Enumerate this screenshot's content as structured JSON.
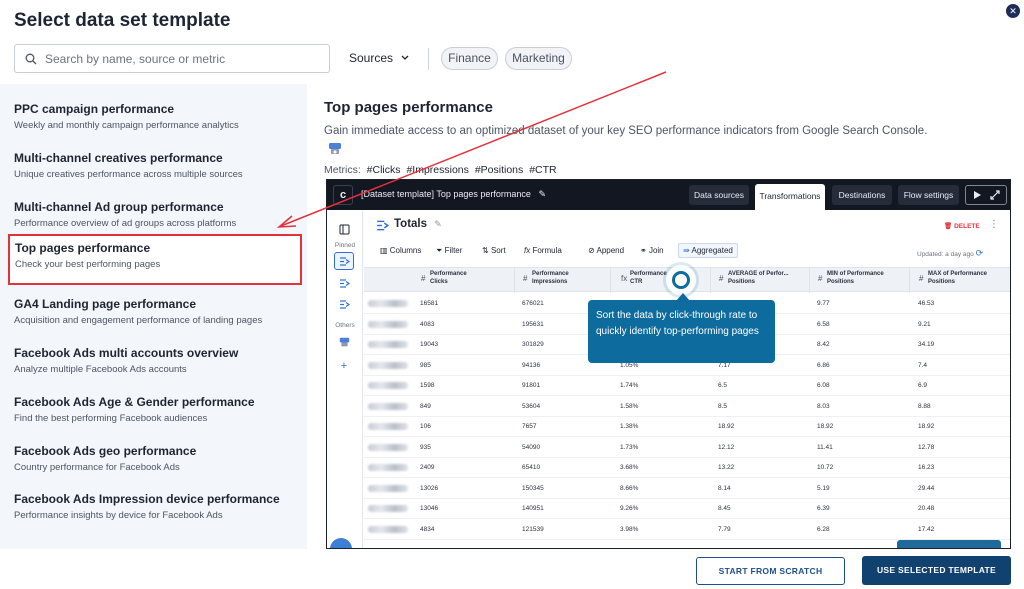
{
  "header": {
    "title": "Select data set template"
  },
  "search": {
    "placeholder": "Search by name, source or metric"
  },
  "filters": {
    "sources_label": "Sources",
    "chips": [
      "Finance",
      "Marketing"
    ]
  },
  "templates": [
    {
      "title": "PPC campaign performance",
      "desc": "Weekly and monthly campaign performance analytics"
    },
    {
      "title": "Multi-channel creatives performance",
      "desc": "Unique creatives performance across multiple sources"
    },
    {
      "title": "Multi-channel Ad group performance",
      "desc": "Performance overview of ad groups across platforms"
    },
    {
      "title": "Top pages performance",
      "desc": "Check your best performing pages"
    },
    {
      "title": "GA4 Landing page performance",
      "desc": "Acquisition and engagement performance of landing pages"
    },
    {
      "title": "Facebook Ads multi accounts overview",
      "desc": "Analyze multiple Facebook Ads accounts"
    },
    {
      "title": "Facebook Ads Age & Gender performance",
      "desc": "Find the best performing Facebook audiences"
    },
    {
      "title": "Facebook Ads geo performance",
      "desc": "Country performance for Facebook Ads"
    },
    {
      "title": "Facebook Ads Impression device performance",
      "desc": "Performance insights by device for Facebook Ads"
    }
  ],
  "detail": {
    "title": "Top pages performance",
    "description": "Gain immediate access to an optimized dataset of your key SEO performance indicators from Google Search Console.",
    "metrics_label": "Metrics:",
    "metrics": [
      "#Clicks",
      "#Impressions",
      "#Positions",
      "#CTR"
    ]
  },
  "preview": {
    "dataset_name": "[Dataset template] Top pages performance",
    "tabs": [
      "Data sources",
      "Transformations",
      "Destinations",
      "Flow settings"
    ],
    "sidebar": {
      "pinned_label": "Pinned",
      "others_label": "Others"
    },
    "totals_title": "Totals",
    "delete_label": "DELETE",
    "toolbar": [
      "Columns",
      "Filter",
      "Sort",
      "Formula",
      "Append",
      "Join",
      "Aggregated"
    ],
    "updated": "Updated: a day ago",
    "columns": [
      [
        "Performance",
        "Clicks"
      ],
      [
        "Performance",
        "Impressions"
      ],
      [
        "Performance",
        "CTR"
      ],
      [
        "AVERAGE of Perfor...",
        "Positions"
      ],
      [
        "MIN of Performance",
        "Positions"
      ],
      [
        "MAX of Performance",
        "Positions"
      ]
    ],
    "rows": [
      [
        "16581",
        "676021",
        "",
        "",
        "9.77",
        "46.53"
      ],
      [
        "4083",
        "195631",
        "",
        "",
        "6.58",
        "9.21"
      ],
      [
        "19043",
        "301829",
        "",
        "",
        "8.42",
        "34.19"
      ],
      [
        "985",
        "94136",
        "1.05%",
        "7.17",
        "6.86",
        "7.4"
      ],
      [
        "1598",
        "91801",
        "1.74%",
        "6.5",
        "6.08",
        "6.9"
      ],
      [
        "849",
        "53604",
        "1.58%",
        "8.5",
        "8.03",
        "8.88"
      ],
      [
        "106",
        "7657",
        "1.38%",
        "18.92",
        "18.92",
        "18.92"
      ],
      [
        "935",
        "54090",
        "1.73%",
        "12.12",
        "11.41",
        "12.78"
      ],
      [
        "2409",
        "65410",
        "3.68%",
        "13.22",
        "10.72",
        "16.23"
      ],
      [
        "13026",
        "150345",
        "8.66%",
        "8.14",
        "5.19",
        "29.44"
      ],
      [
        "13046",
        "140951",
        "9.26%",
        "8.45",
        "6.39",
        "20.48"
      ],
      [
        "4834",
        "121539",
        "3.98%",
        "7.79",
        "6.28",
        "17.42"
      ]
    ]
  },
  "tooltip": {
    "text": "Sort the data by click-through rate to quickly identify top-performing pages"
  },
  "footer": {
    "scratch_label": "START FROM SCRATCH",
    "use_label": "USE SELECTED TEMPLATE"
  },
  "colors": {
    "accent": "#10416f",
    "highlight": "#e2323c",
    "tooltip": "#0e6b9e"
  }
}
